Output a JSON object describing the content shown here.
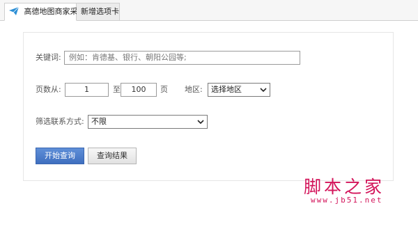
{
  "tabs": [
    {
      "label": "高德地图商家采集",
      "icon": "send-icon"
    },
    {
      "label": "新增选项卡"
    }
  ],
  "form": {
    "keyword_label": "关键词:",
    "keyword_placeholder": "例如：肯德基、银行、朝阳公园等;",
    "pages_from_label": "页数从:",
    "page_start": "1",
    "pages_to_label": "至:",
    "page_end": "100",
    "page_unit": "页",
    "region_label": "地区:",
    "region_selected": "选择地区",
    "contact_filter_label": "筛选联系方式:",
    "contact_filter_selected": "不限"
  },
  "buttons": {
    "start_query": "开始查询",
    "query_results": "查询结果"
  },
  "watermark": {
    "text": "脚本之家",
    "url": "www.jb51.net"
  }
}
